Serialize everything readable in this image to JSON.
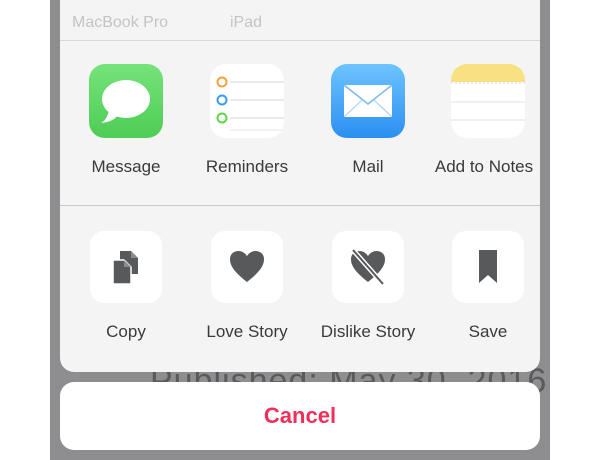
{
  "airdrop": {
    "devices": [
      "MacBook Pro",
      "iPad"
    ]
  },
  "apps": [
    {
      "label": "Message",
      "icon": "messages-icon"
    },
    {
      "label": "Reminders",
      "icon": "reminders-icon"
    },
    {
      "label": "Mail",
      "icon": "mail-icon"
    },
    {
      "label": "Add to Notes",
      "icon": "notes-icon"
    }
  ],
  "actions": [
    {
      "label": "Copy",
      "icon": "copy-icon"
    },
    {
      "label": "Love Story",
      "icon": "heart-icon"
    },
    {
      "label": "Dislike Story",
      "icon": "broken-heart-icon"
    },
    {
      "label": "Save",
      "icon": "bookmark-icon"
    }
  ],
  "backdrop": {
    "text": "Published: May 30, 2016"
  },
  "cancel_label": "Cancel",
  "colors": {
    "cancel": "#f0305a",
    "icon_gray": "#58595b",
    "messages_green": "#5fd764",
    "mail_blue": "#3aa0f5",
    "notes_yellow": "#f9e183"
  }
}
